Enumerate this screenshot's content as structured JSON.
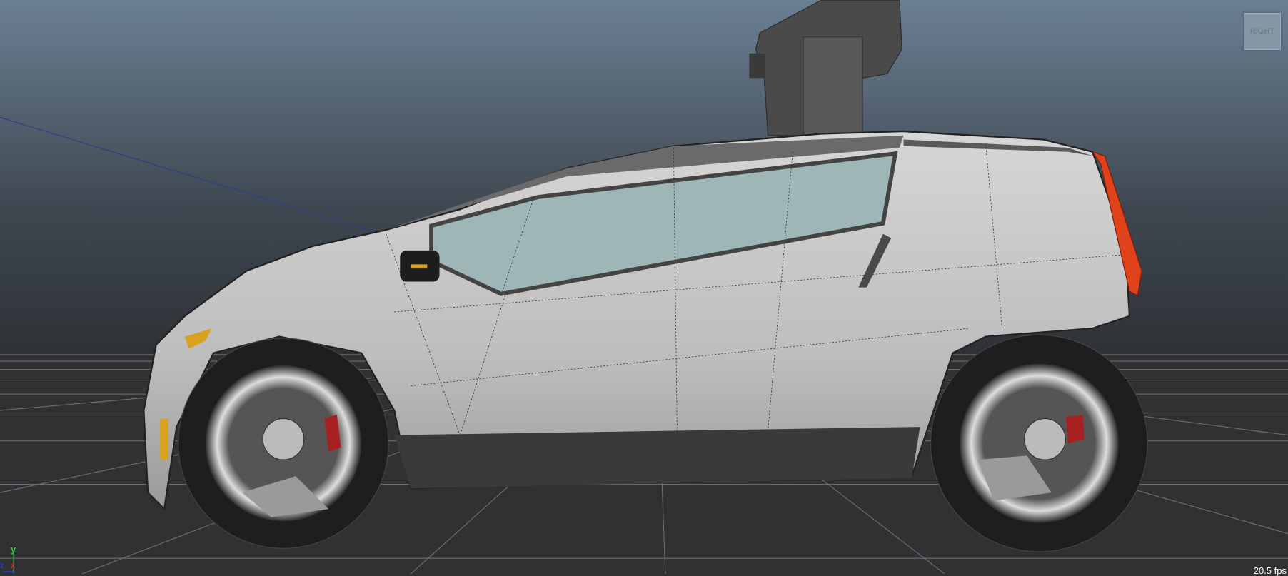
{
  "viewport": {
    "view_cube_label": "RIGHT",
    "fps_readout": "20.5 fps",
    "axis_labels": {
      "y": "y",
      "x": "x",
      "z": "z"
    }
  },
  "colors": {
    "sky_top": "#6b7f93",
    "sky_bottom": "#2e3236",
    "ground": "#2f3133",
    "grid": "#6b6e71",
    "body": "#c9c9c9",
    "glass": "#9fb6b7",
    "tail_light": "#e0421c",
    "indicator": "#d9a21c"
  }
}
